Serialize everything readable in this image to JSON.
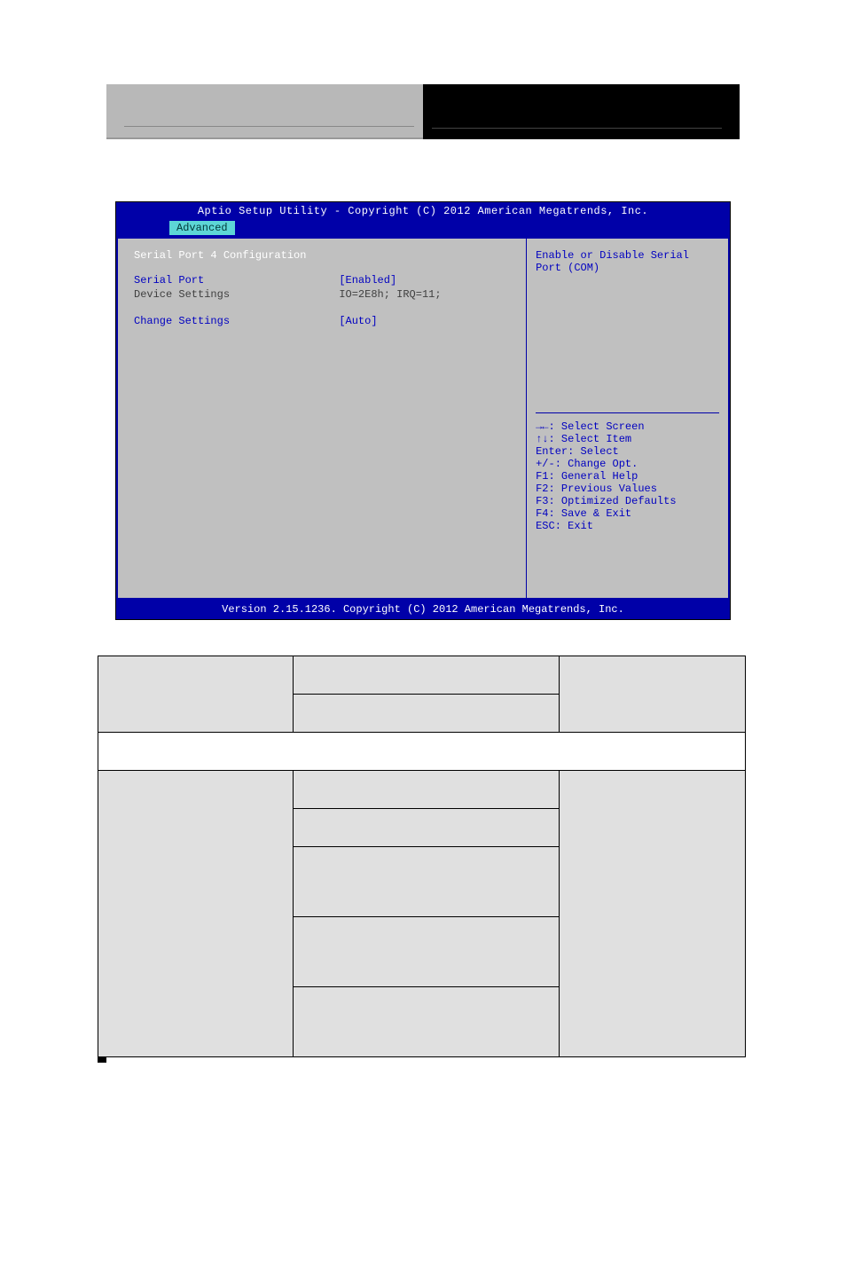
{
  "bios": {
    "title": "Aptio Setup Utility - Copyright (C) 2012 American Megatrends, Inc.",
    "tab": "Advanced",
    "section_title": "Serial Port 4 Configuration",
    "rows": {
      "serial_port": {
        "label": "Serial Port",
        "value": "[Enabled]"
      },
      "device_settings": {
        "label": "Device Settings",
        "value": "IO=2E8h; IRQ=11;"
      },
      "change_settings": {
        "label": "Change Settings",
        "value": "[Auto]"
      }
    },
    "help_text": "Enable or Disable Serial Port (COM)",
    "nav": {
      "l1": "→←: Select Screen",
      "l2": "↑↓: Select Item",
      "l3": "Enter: Select",
      "l4": "+/-: Change Opt.",
      "l5": "F1: General Help",
      "l6": "F2: Previous Values",
      "l7": "F3: Optimized Defaults",
      "l8": "F4: Save & Exit",
      "l9": "ESC: Exit"
    },
    "footer": "Version 2.15.1236. Copyright (C) 2012 American Megatrends, Inc."
  },
  "table": {
    "r1c1": "",
    "r1c2": "",
    "r1c3": "",
    "r2c1": "",
    "r2c2": "",
    "r2c3": "",
    "r3span": "",
    "r4c1": "",
    "r4c2": "",
    "r4c3": "",
    "r5c2": "",
    "r6c2": "",
    "r7c2": "",
    "r8c2": ""
  }
}
